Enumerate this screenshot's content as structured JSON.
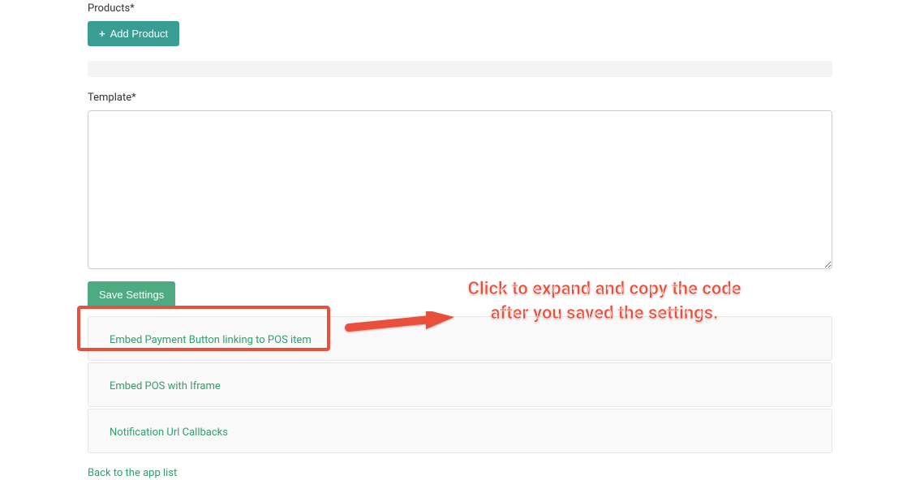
{
  "products": {
    "label": "Products*",
    "add_button": "Add Product"
  },
  "template": {
    "label": "Template*",
    "value": ""
  },
  "save_button": "Save Settings",
  "accordion": {
    "items": [
      {
        "label": "Embed Payment Button linking to POS item"
      },
      {
        "label": "Embed POS with Iframe"
      },
      {
        "label": "Notification Url Callbacks"
      }
    ]
  },
  "back_link": "Back to the app list",
  "annotation": {
    "text": "Click to expand and copy the code after you saved the settings."
  },
  "colors": {
    "accent": "#329d6e",
    "button_teal": "#3a9d93",
    "button_green": "#4eab81",
    "highlight_red": "#ea4f3a"
  }
}
